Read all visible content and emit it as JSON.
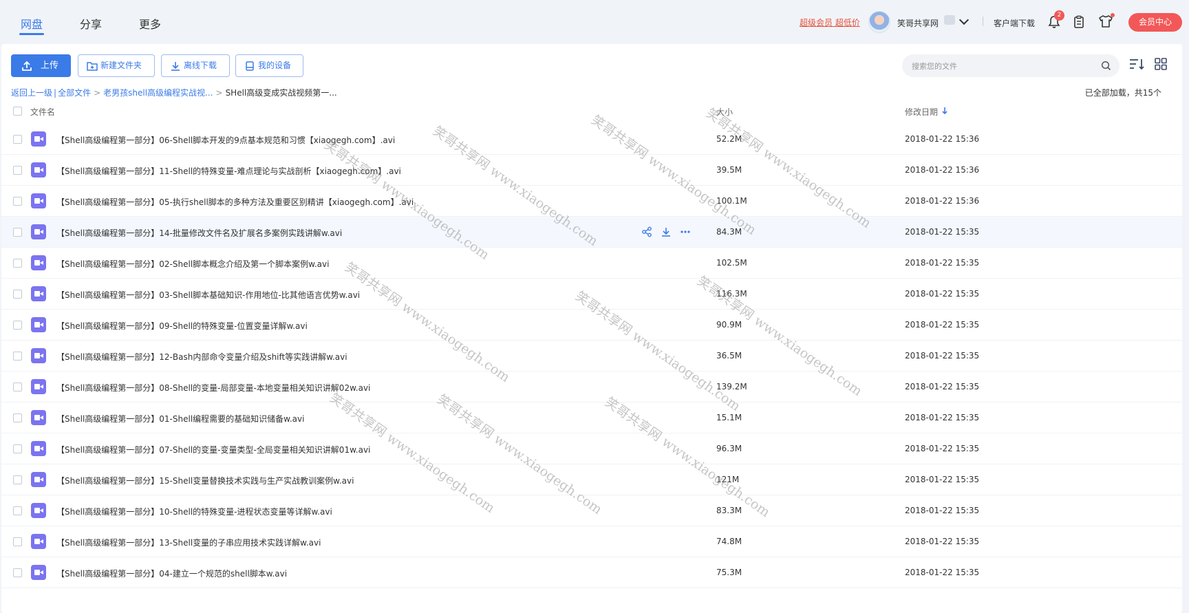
{
  "nav": {
    "tabs": [
      "网盘",
      "分享",
      "更多"
    ],
    "super_link": "超级会员 超低价",
    "username": "笑哥共享网",
    "client_download": "客户端下载",
    "notification_count": "2",
    "vip_center": "会员中心"
  },
  "toolbar": {
    "upload": "上传",
    "new_folder": "新建文件夹",
    "offline_download": "离线下载",
    "my_devices": "我的设备",
    "search_placeholder": "搜索您的文件"
  },
  "breadcrumb": {
    "back": "返回上一级",
    "all_files": "全部文件",
    "folder1": "老男孩shell高级编程实战视...",
    "current": "SHell高级变成实战视频第一...",
    "loaded_info": "已全部加载，共15个"
  },
  "table": {
    "col_name": "文件名",
    "col_size": "大小",
    "col_date": "修改日期",
    "rows": [
      {
        "name": "【Shell高级编程第一部分】06-Shell脚本开发的9点基本规范和习惯【xiaogegh.com】.avi",
        "size": "52.2M",
        "date": "2018-01-22 15:36"
      },
      {
        "name": "【Shell高级编程第一部分】11-Shell的特殊变量-难点理论与实战剖析【xiaogegh.com】.avi",
        "size": "39.5M",
        "date": "2018-01-22 15:36"
      },
      {
        "name": "【Shell高级编程第一部分】05-执行shell脚本的多种方法及重要区别精讲【xiaogegh.com】.avi",
        "size": "100.1M",
        "date": "2018-01-22 15:36"
      },
      {
        "name": "【Shell高级编程第一部分】14-批量修改文件名及扩展名多案例实践讲解w.avi",
        "size": "84.3M",
        "date": "2018-01-22 15:35"
      },
      {
        "name": "【Shell高级编程第一部分】02-Shell脚本概念介绍及第一个脚本案例w.avi",
        "size": "102.5M",
        "date": "2018-01-22 15:35"
      },
      {
        "name": "【Shell高级编程第一部分】03-Shell脚本基础知识-作用地位-比其他语言优势w.avi",
        "size": "116.3M",
        "date": "2018-01-22 15:35"
      },
      {
        "name": "【Shell高级编程第一部分】09-Shell的特殊变量-位置变量详解w.avi",
        "size": "90.9M",
        "date": "2018-01-22 15:35"
      },
      {
        "name": "【Shell高级编程第一部分】12-Bash内部命令变量介绍及shift等实践讲解w.avi",
        "size": "36.5M",
        "date": "2018-01-22 15:35"
      },
      {
        "name": "【Shell高级编程第一部分】08-Shell的变量-局部变量-本地变量相关知识讲解02w.avi",
        "size": "139.2M",
        "date": "2018-01-22 15:35"
      },
      {
        "name": "【Shell高级编程第一部分】01-Shell编程需要的基础知识储备w.avi",
        "size": "15.1M",
        "date": "2018-01-22 15:35"
      },
      {
        "name": "【Shell高级编程第一部分】07-Shell的变量-变量类型-全局变量相关知识讲解01w.avi",
        "size": "96.3M",
        "date": "2018-01-22 15:35"
      },
      {
        "name": "【Shell高级编程第一部分】15-Shell变量替换技术实践与生产实战教训案例w.avi",
        "size": "121M",
        "date": "2018-01-22 15:35"
      },
      {
        "name": "【Shell高级编程第一部分】10-Shell的特殊变量-进程状态变量等详解w.avi",
        "size": "83.3M",
        "date": "2018-01-22 15:35"
      },
      {
        "name": "【Shell高级编程第一部分】13-Shell变量的子串应用技术实践详解w.avi",
        "size": "74.8M",
        "date": "2018-01-22 15:35"
      },
      {
        "name": "【Shell高级编程第一部分】04-建立一个规范的shell脚本w.avi",
        "size": "75.3M",
        "date": "2018-01-22 15:35"
      }
    ]
  },
  "watermark": "笑哥共享网 www.xiaogegh.com"
}
